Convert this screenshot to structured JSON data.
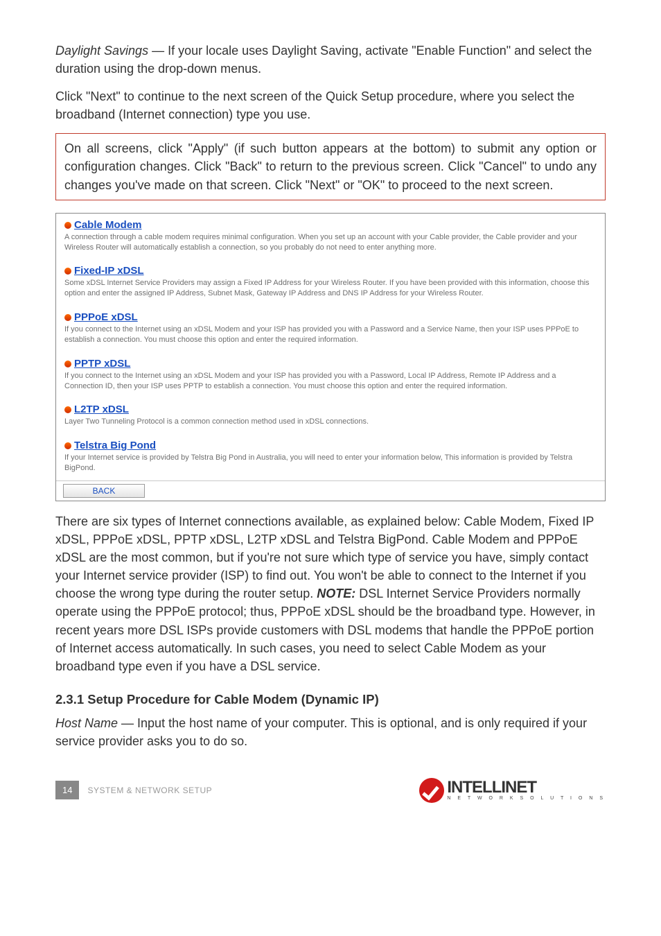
{
  "intro": {
    "daylight_label": "Daylight Savings",
    "daylight_rest": " — If your locale uses Daylight Saving, activate \"Enable Function\" and select the duration using the drop-down menus.",
    "click_next": "Click \"Next\" to continue to the next screen of the Quick Setup procedure, where you select the broadband (Internet connection) type you use.",
    "callout": "On all screens, click \"Apply\" (if such button appears at the bottom) to submit any option or configuration changes. Click \"Back\" to return to the previous screen. Click \"Cancel\" to undo any changes you've made on that screen. Click \"Next\" or \"OK\" to proceed to the next screen."
  },
  "connections": [
    {
      "name": "cable-modem",
      "title": "Cable Modem",
      "desc": "A connection through a cable modem requires minimal configuration. When you set up an account with your Cable provider, the Cable provider and your Wireless Router will automatically establish a connection, so you probably do not need to enter anything more."
    },
    {
      "name": "fixed-ip-xdsl",
      "title": "Fixed-IP xDSL",
      "desc": "Some xDSL Internet Service Providers may assign a Fixed IP Address for your Wireless Router. If you have been provided with this information, choose this option and enter the assigned IP Address, Subnet Mask, Gateway IP Address and DNS IP Address for your Wireless Router."
    },
    {
      "name": "pppoe-xdsl",
      "title": "PPPoE xDSL",
      "desc": "If you connect to the Internet using an xDSL Modem and your ISP has provided you with a Password and a Service Name, then your ISP uses PPPoE to establish a connection. You must choose this option and enter the required information."
    },
    {
      "name": "pptp-xdsl",
      "title": "PPTP xDSL",
      "desc": "If you connect to the Internet using an xDSL Modem and your ISP has provided you with a Password, Local IP Address, Remote IP Address and a Connection ID, then your ISP uses PPTP to establish a connection. You must choose this option and enter the required information."
    },
    {
      "name": "l2tp-xdsl",
      "title": "L2TP xDSL",
      "desc": "Layer Two Tunneling Protocol is a common connection method used in xDSL connections."
    },
    {
      "name": "telstra-big-pond",
      "title": "Telstra Big Pond",
      "desc": "If your Internet service is provided by Telstra Big Pond in Australia, you will need to enter your information below, This information is provided by Telstra BigPond."
    }
  ],
  "back_label": "BACK",
  "explain": {
    "p1a": "There are six types of Internet connections available, as explained below: Cable Modem, Fixed IP xDSL, PPPoE xDSL, PPTP xDSL, L2TP xDSL and Telstra BigPond. Cable Modem and PPPoE xDSL are the most common, but if you're not sure which type of service you have, simply contact your Internet service provider (ISP) to find out. You won't be able to connect to the Internet if you choose the wrong type during the router setup. ",
    "note_label": "NOTE:",
    "p1b": " DSL Internet Service Providers normally operate using the PPPoE protocol; thus, PPPoE xDSL should be the broadband type. However, in recent years more DSL ISPs provide customers with DSL modems that handle the PPPoE portion of Internet access automatically. In such cases, you need to select Cable Modem as your broadband type even if you have a DSL service."
  },
  "section_heading": "2.3.1  Setup Procedure for Cable Modem (Dynamic IP)",
  "hostname": {
    "label": "Host Name",
    "rest": " — Input the host name of your computer. This is optional, and is only required if your service provider asks you to do so."
  },
  "footer": {
    "page": "14",
    "text": "SYSTEM & NETWORK SETUP",
    "logo_main": "INTELLINET",
    "logo_sub": "N E T W O R K   S O L U T I O N S"
  }
}
